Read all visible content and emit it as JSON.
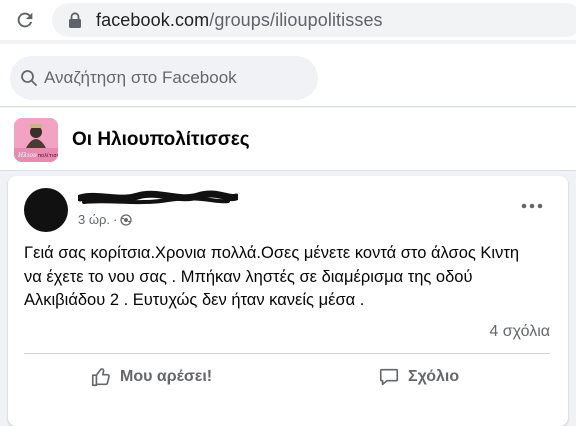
{
  "browser": {
    "url_host": "facebook.com",
    "url_path": "/groups/ilioupolitisses"
  },
  "header": {
    "search_placeholder": "Αναζήτηση στο Facebook"
  },
  "group": {
    "name": "Οι Ηλιουπολίτισσες",
    "avatar_caption": "Ηλιου πολίτισσ"
  },
  "post": {
    "time": "3 ώρ.",
    "separator": "·",
    "text_lines": [
      "Γειά σας κορίτσια.Χρονια πολλά.Οσες μένετε κοντά στο άλσος Κιντη",
      "να έχετε το νου σας . Μπήκαν ληστές σε  διαμέρισμα της οδού",
      "Αλκιβιάδου 2 . Ευτυχώς δεν ήταν κανείς μέσα ."
    ],
    "comments_count": "4 σχόλια",
    "like_label": "Μου αρέσει!",
    "comment_label": "Σχόλιο"
  },
  "icons": {
    "reload": "reload-icon",
    "lock": "lock-icon",
    "search": "search-icon",
    "globe": "globe-icon",
    "more": "more-options-icon",
    "like": "thumbs-up-icon",
    "comment": "comment-bubble-icon"
  }
}
